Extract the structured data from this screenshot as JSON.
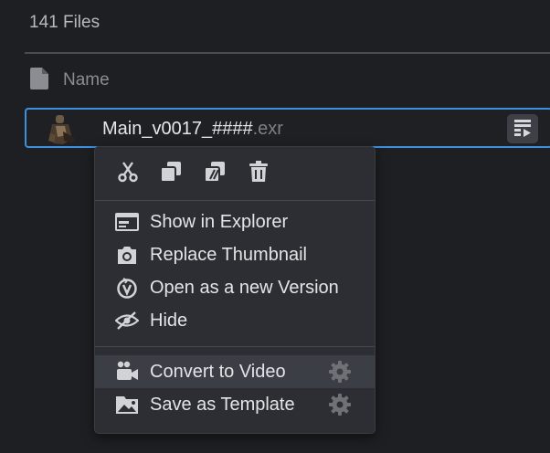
{
  "header": {
    "file_count": "141 Files"
  },
  "columns": {
    "name_label": "Name"
  },
  "file": {
    "name": "Main_v0017_####",
    "extension": ".exr"
  },
  "menu": {
    "toolbar": [
      {
        "icon": "scissors-icon",
        "action": "cut"
      },
      {
        "icon": "copy-icon",
        "action": "copy"
      },
      {
        "icon": "rename-icon",
        "action": "rename"
      },
      {
        "icon": "trash-icon",
        "action": "delete"
      }
    ],
    "items": [
      {
        "label": "Show in Explorer",
        "icon": "explorer-icon"
      },
      {
        "label": "Replace Thumbnail",
        "icon": "camera-icon"
      },
      {
        "label": "Open as a new Version",
        "icon": "version-icon"
      },
      {
        "label": "Hide",
        "icon": "eye-slash-icon"
      }
    ],
    "actions": [
      {
        "label": "Convert to Video",
        "icon": "video-camera-icon",
        "has_settings": true,
        "highlighted": true
      },
      {
        "label": "Save as Template",
        "icon": "template-folder-icon",
        "has_settings": true,
        "highlighted": false
      }
    ]
  },
  "colors": {
    "accent": "#3d8fe0",
    "background": "#1e1f22",
    "menu": "#2c2e33"
  }
}
